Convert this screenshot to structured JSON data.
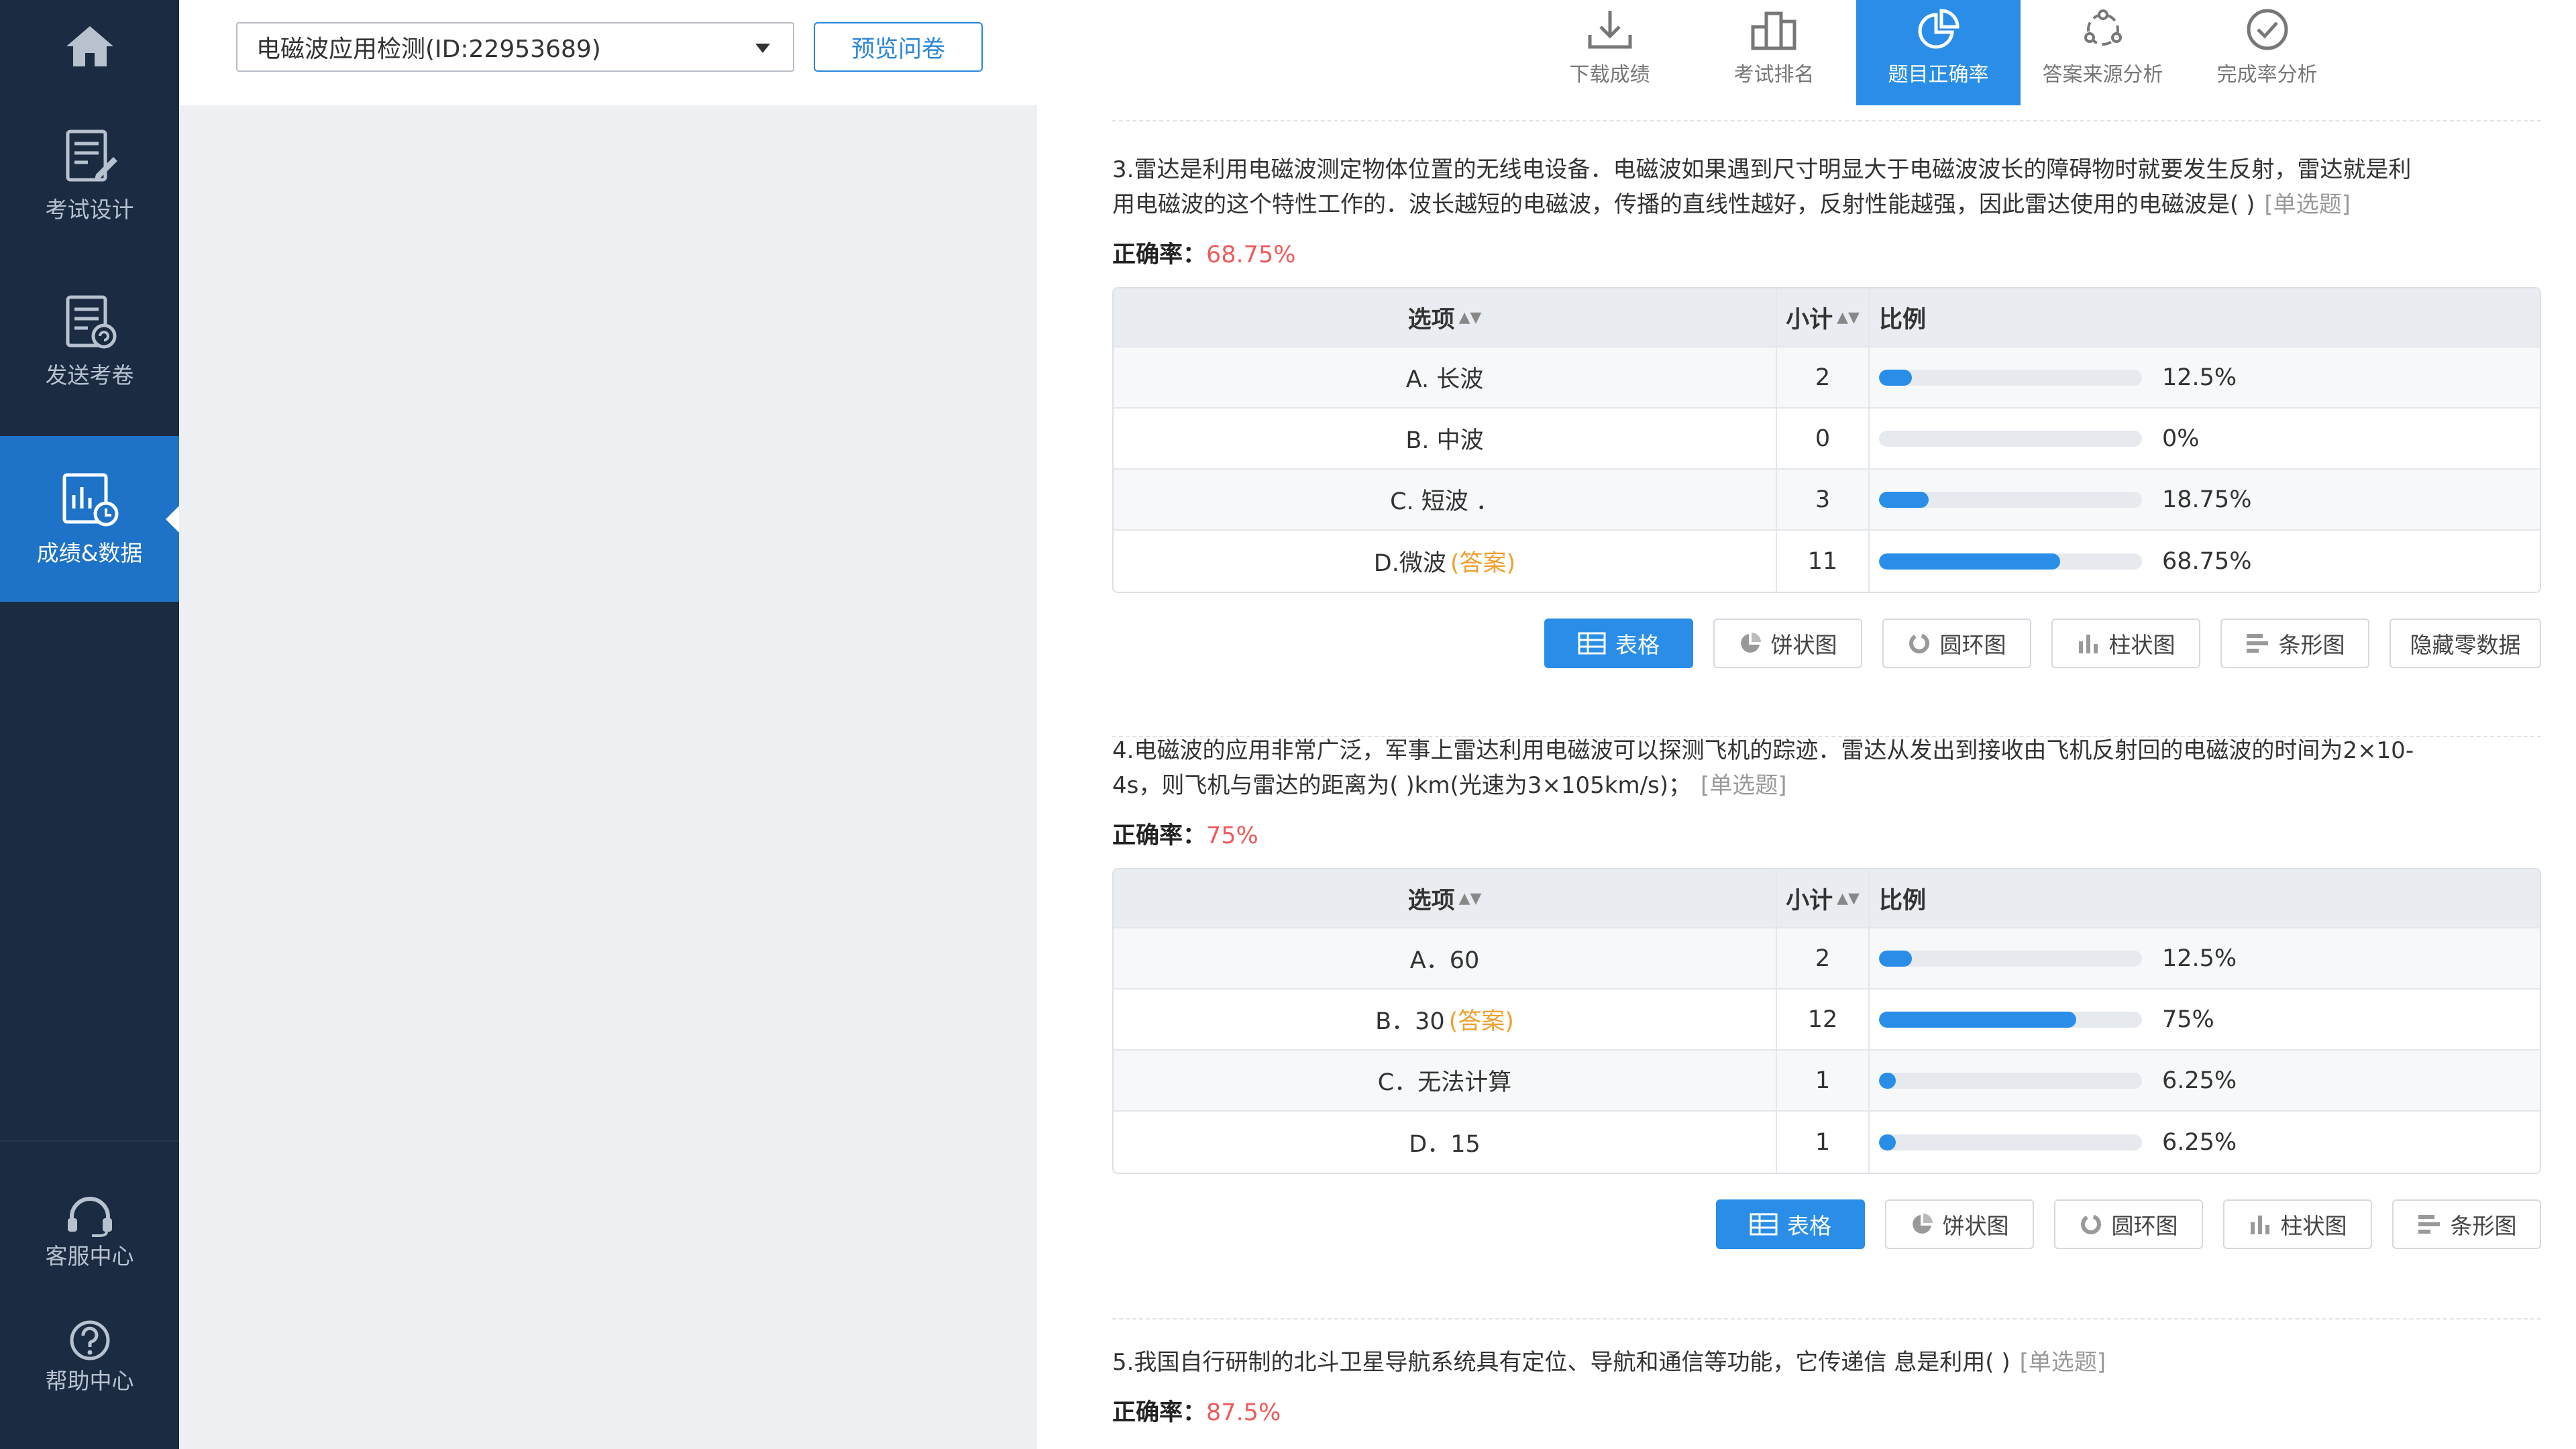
{
  "sidebar": {
    "items": [
      {
        "label": "",
        "icon": "home-icon"
      },
      {
        "label": "考试设计",
        "icon": "exam-design-icon"
      },
      {
        "label": "发送考卷",
        "icon": "send-exam-icon"
      },
      {
        "label": "成绩&数据",
        "icon": "data-chart-icon",
        "active": true
      }
    ],
    "bottom": [
      {
        "label": "客服中心",
        "icon": "headset-icon"
      },
      {
        "label": "帮助中心",
        "icon": "help-icon"
      }
    ]
  },
  "header": {
    "survey_select": "电磁波应用检测(ID:22953689)",
    "preview_label": "预览问卷",
    "tools": [
      {
        "label": "下载成绩",
        "icon": "download-icon"
      },
      {
        "label": "考试排名",
        "icon": "ranking-icon"
      },
      {
        "label": "题目正确率",
        "icon": "pie-chart-icon",
        "active": true
      },
      {
        "label": "答案来源分析",
        "icon": "source-network-icon"
      },
      {
        "label": "完成率分析",
        "icon": "check-circle-icon"
      }
    ]
  },
  "table_headers": {
    "option": "选项",
    "count": "小计",
    "ratio": "比例"
  },
  "rate_label": "正确率：",
  "answer_tag": "(答案)",
  "view_buttons": [
    "表格",
    "饼状图",
    "圆环图",
    "柱状图",
    "条形图",
    "隐藏零数据"
  ],
  "questions": [
    {
      "text": "3.雷达是利用电磁波测定物体位置的无线电设备．电磁波如果遇到尺寸明显大于电磁波波长的障碍物时就要发生反射，雷达就是利用电磁波的这个特性工作的．波长越短的电磁波，传播的直线性越好，反射性能越强，因此雷达使用的电磁波是( )",
      "type": "[单选题]",
      "rate": "68.75%",
      "options": [
        {
          "label": "A. 长波",
          "count": "2",
          "pct": "12.5%",
          "fraction": 0.125,
          "answer": false
        },
        {
          "label": "B. 中波",
          "count": "0",
          "pct": "0%",
          "fraction": 0,
          "answer": false
        },
        {
          "label": "C. 短波 ．",
          "count": "3",
          "pct": "18.75%",
          "fraction": 0.1875,
          "answer": false
        },
        {
          "label": "D.微波",
          "count": "11",
          "pct": "68.75%",
          "fraction": 0.6875,
          "answer": true
        }
      ]
    },
    {
      "text": "4.电磁波的应用非常广泛，军事上雷达利用电磁波可以探测飞机的踪迹．雷达从发出到接收由飞机反射回的电磁波的时间为2×10-4s，则飞机与雷达的距离为( )km(光速为3×105km/s)；",
      "type": "[单选题]",
      "rate": "75%",
      "options": [
        {
          "label": "A．60",
          "count": "2",
          "pct": "12.5%",
          "fraction": 0.125,
          "answer": false
        },
        {
          "label": "B．30",
          "count": "12",
          "pct": "75%",
          "fraction": 0.75,
          "answer": true
        },
        {
          "label": "C．无法计算",
          "count": "1",
          "pct": "6.25%",
          "fraction": 0.0625,
          "answer": false
        },
        {
          "label": "D．15",
          "count": "1",
          "pct": "6.25%",
          "fraction": 0.0625,
          "answer": false
        }
      ]
    },
    {
      "text": "5.我国自行研制的北斗卫星导航系统具有定位、导航和通信等功能，它传递信 息是利用( )",
      "type": "[单选题]",
      "rate": "87.5%"
    }
  ],
  "colors": {
    "accent": "#2a8ee8",
    "sidebar": "#1a2b42",
    "rate": "#f05a5a",
    "answer": "#f0a030"
  }
}
